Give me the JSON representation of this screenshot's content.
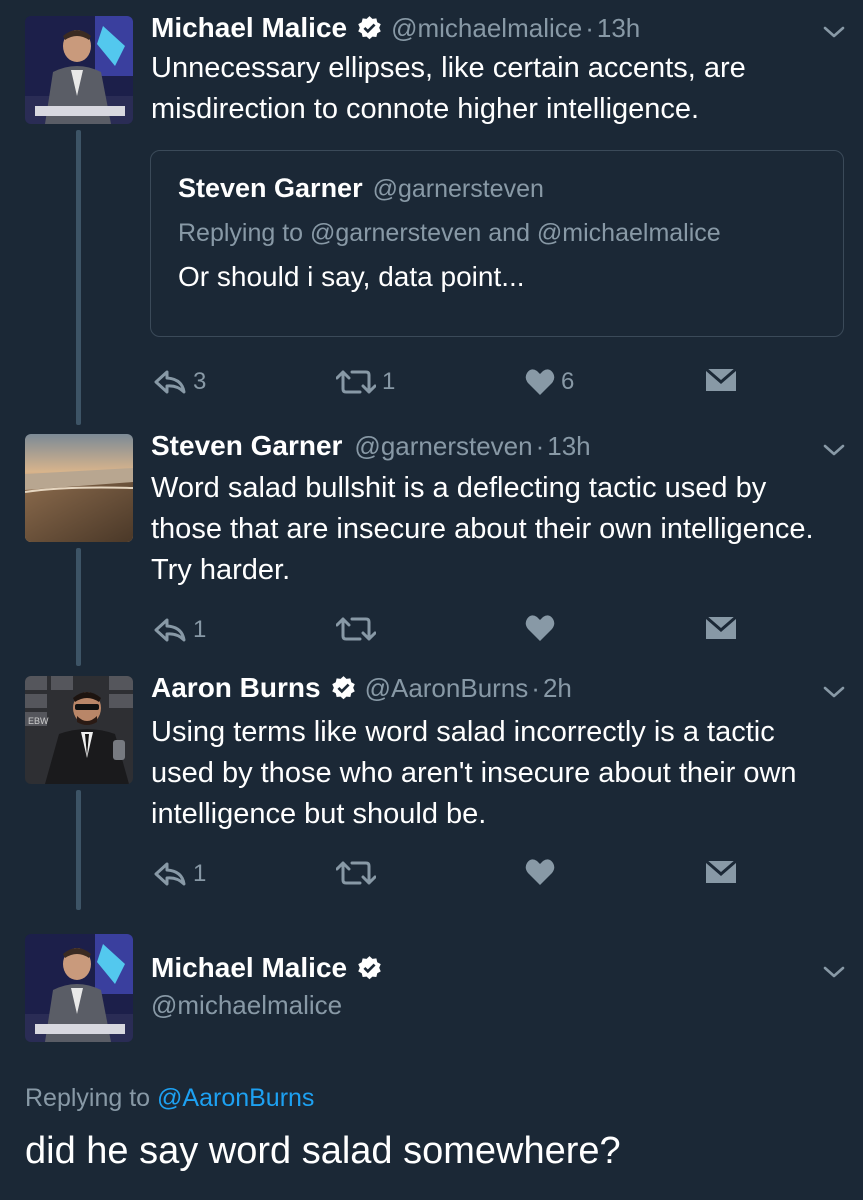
{
  "tweets": [
    {
      "name": "Michael Malice",
      "handle": "@michaelmalice",
      "time": "13h",
      "verified": true,
      "text": "Unnecessary ellipses, like certain accents, are misdirection to connote higher intelligence.",
      "quote": {
        "name": "Steven Garner",
        "handle": "@garnersteven",
        "replying": "Replying to @garnersteven and @michaelmalice",
        "text": "Or should i say, data point..."
      },
      "replies": "3",
      "retweets": "1",
      "likes": "6"
    },
    {
      "name": "Steven Garner",
      "handle": "@garnersteven",
      "time": "13h",
      "verified": false,
      "text": "Word salad bullshit is a deflecting tactic used by those that are insecure about their own intelligence. Try harder.",
      "replies": "1",
      "retweets": "",
      "likes": ""
    },
    {
      "name": "Aaron Burns",
      "handle": "@AaronBurns",
      "time": "2h",
      "verified": true,
      "text": "Using terms like word salad incorrectly is a tactic used by those who aren't insecure about their own intelligence but should be.",
      "replies": "1",
      "retweets": "",
      "likes": ""
    }
  ],
  "main_tweet": {
    "name": "Michael Malice",
    "handle": "@michaelmalice",
    "verified": true,
    "replying_prefix": "Replying to",
    "replying_to": "@AaronBurns",
    "text": "did he say word salad somewhere?"
  },
  "separator": "·",
  "colors": {
    "background": "#1b2836",
    "muted": "#8899a6",
    "link": "#1da1f2",
    "thread_line": "#3d5466",
    "quote_border": "#3b4a59"
  }
}
